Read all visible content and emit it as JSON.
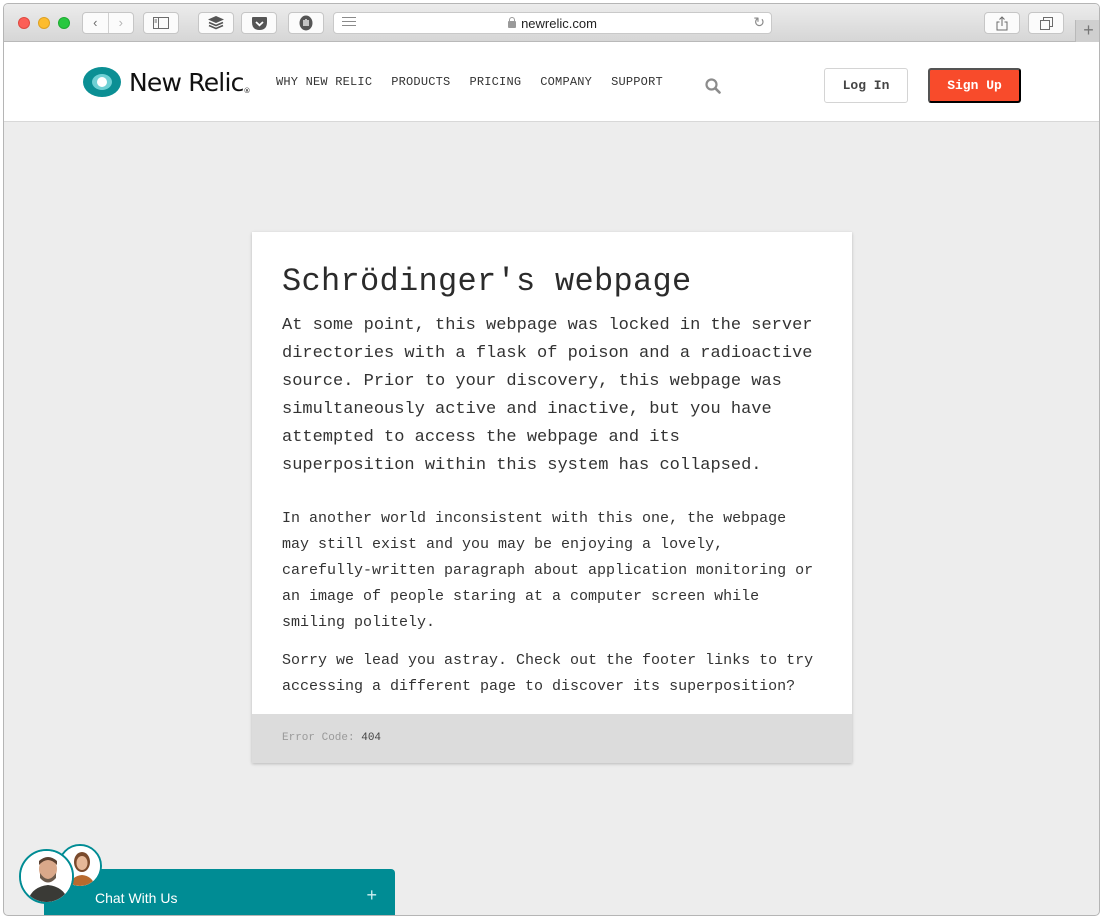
{
  "browser": {
    "url": "newrelic.com",
    "back_label": "‹",
    "forward_label": "›",
    "new_tab_label": "+"
  },
  "header": {
    "logo_text": "New Relic",
    "logo_mark": "®",
    "nav": [
      {
        "label": "WHY NEW RELIC"
      },
      {
        "label": "PRODUCTS"
      },
      {
        "label": "PRICING"
      },
      {
        "label": "COMPANY"
      },
      {
        "label": "SUPPORT"
      }
    ],
    "login_label": "Log In",
    "signup_label": "Sign Up",
    "colors": {
      "accent": "#f84b2b",
      "brand": "#008c94"
    }
  },
  "error_card": {
    "title": "Schrödinger's webpage",
    "lead": "At some point, this webpage was locked in the server directories with a flask of poison and a radioactive source. Prior to your discovery, this webpage was simultaneously active and inactive, but you have attempted to access the webpage and its superposition within this system has collapsed.",
    "paragraphs": [
      "In another world inconsistent with this one, the webpage may still exist and you may be enjoying a lovely, carefully-written paragraph about application monitoring or an image of people staring at a computer screen while smiling politely.",
      "Sorry we lead you astray. Check out the footer links to try accessing a different page to discover its superposition?"
    ],
    "error_label": "Error Code:",
    "error_code": "404"
  },
  "chat": {
    "label": "Chat With Us",
    "expand_label": "+"
  }
}
